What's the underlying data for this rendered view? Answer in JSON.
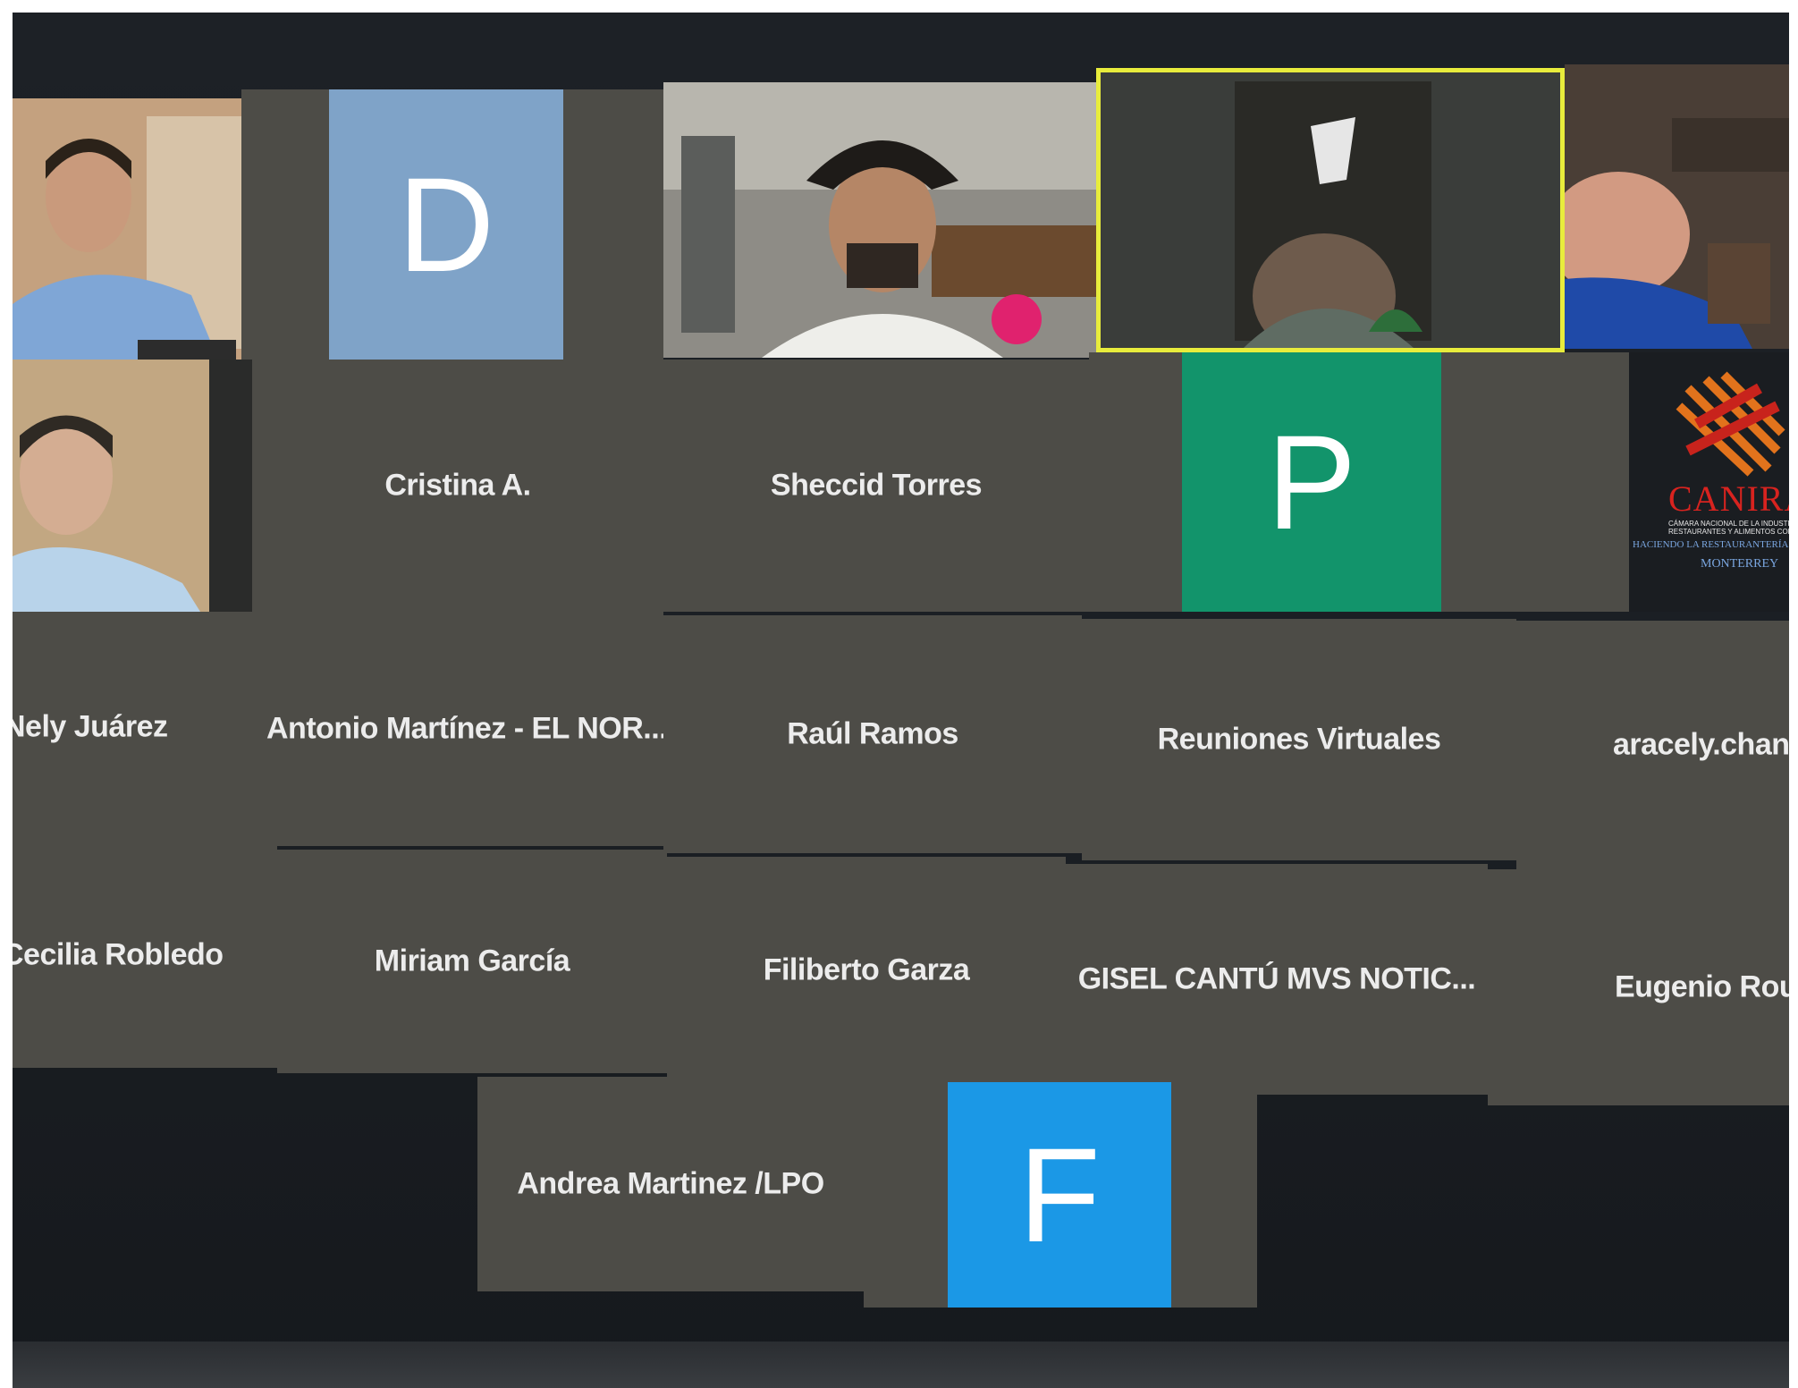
{
  "participants": {
    "row1": {
      "avatar_d": {
        "initial": "D",
        "color": "#7fa3c8"
      }
    },
    "row2": {
      "cristina": "Cristina A.",
      "sheccid": "Sheccid Torres",
      "avatar_p": {
        "initial": "P",
        "color": "#12946b"
      },
      "logo": {
        "brand": "CANIRA",
        "line1": "CÁMARA NACIONAL DE LA INDUSTRIA DE",
        "line2": "RESTAURANTES Y ALIMENTOS CONDIMENTADOS",
        "tagline": "HACIENDO LA RESTAURANTERÍA",
        "city": "MONTERREY"
      }
    },
    "row3": {
      "nely": "Nely Juárez",
      "antonio": "Antonio Martínez - EL NOR...",
      "raul": "Raúl Ramos",
      "reuniones": "Reuniones Virtuales",
      "aracely": "aracely.chant"
    },
    "row4": {
      "cecilia": "Cecilia Robledo",
      "miriam": "Miriam García",
      "filiberto": "Filiberto Garza",
      "gisel": "GISEL CANTÚ MVS NOTIC...",
      "eugenio": "Eugenio Roux"
    },
    "row5": {
      "andrea": "Andrea Martinez /LPO",
      "avatar_f": {
        "initial": "F",
        "color": "#1b98e6"
      }
    }
  },
  "colors": {
    "tile_bg": "#4d4c47",
    "speaker_border": "#e8ec3c",
    "screen_bg": "#1b1f24"
  }
}
